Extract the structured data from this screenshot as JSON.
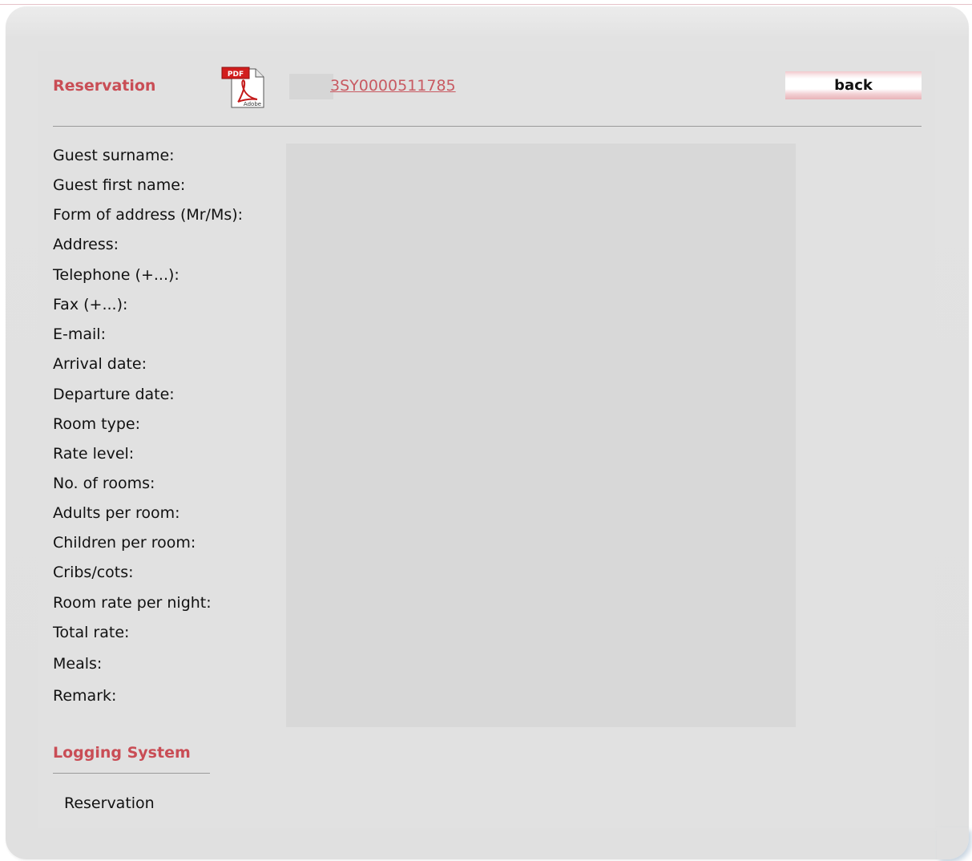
{
  "header": {
    "title": "Reservation",
    "reservation_number": "3SY0000511785",
    "back_label": "back"
  },
  "fields": [
    {
      "label": "Guest surname:"
    },
    {
      "label": "Guest first name:"
    },
    {
      "label": "Form of address (Mr/Ms):"
    },
    {
      "label": "Address:"
    },
    {
      "label": "Telephone (+...):"
    },
    {
      "label": "Fax (+...):"
    },
    {
      "label": "E-mail:"
    },
    {
      "label": "Arrival date:"
    },
    {
      "label": "Departure date:"
    },
    {
      "label": "Room type:"
    },
    {
      "label": "Rate level:"
    },
    {
      "label": "No. of rooms:"
    },
    {
      "label": "Adults per room:"
    },
    {
      "label": "Children per room:"
    },
    {
      "label": "Cribs/cots:"
    },
    {
      "label": "Room rate per night:"
    },
    {
      "label": "Total rate:"
    },
    {
      "label": "Meals:"
    },
    {
      "label": "Remark:"
    }
  ],
  "logging": {
    "title": "Logging System",
    "items": [
      "Reservation"
    ]
  },
  "icons": {
    "pdf": "pdf-adobe-icon"
  },
  "colors": {
    "accent": "#c94d55",
    "link": "#c85a62",
    "panel_bg": "#e1e1e1",
    "values_bg": "#d8d8d8"
  }
}
